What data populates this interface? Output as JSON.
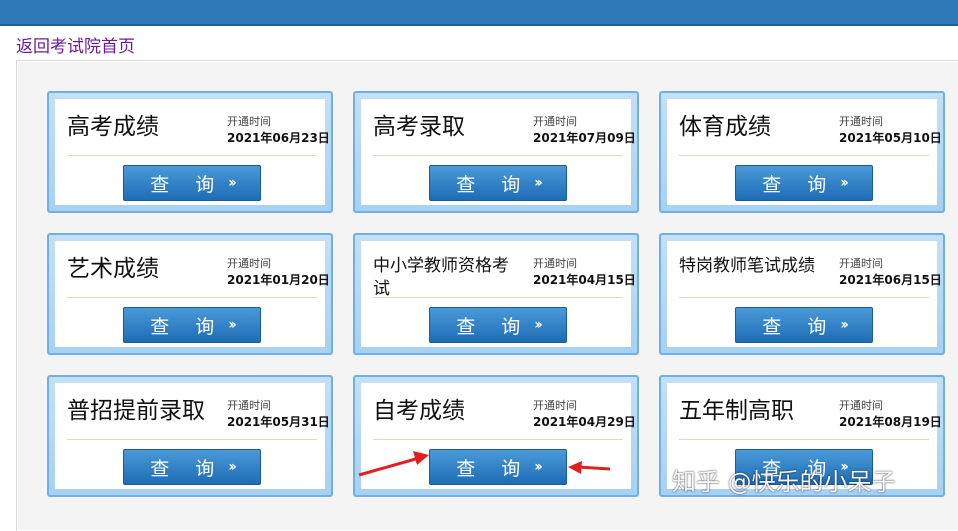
{
  "back_link": "返回考试院首页",
  "cards": [
    {
      "title": "高考成绩",
      "open_label": "开通时间",
      "open_date": "2021年06月23日",
      "button": "查 询"
    },
    {
      "title": "高考录取",
      "open_label": "开通时间",
      "open_date": "2021年07月09日",
      "button": "查 询"
    },
    {
      "title": "体育成绩",
      "open_label": "开通时间",
      "open_date": "2021年05月10日",
      "button": "查 询"
    },
    {
      "title": "艺术成绩",
      "open_label": "开通时间",
      "open_date": "2021年01月20日",
      "button": "查 询"
    },
    {
      "title": "中小学教师资格考试",
      "open_label": "开通时间",
      "open_date": "2021年04月15日",
      "button": "查 询"
    },
    {
      "title": "特岗教师笔试成绩",
      "open_label": "开通时间",
      "open_date": "2021年06月15日",
      "button": "查 询"
    },
    {
      "title": "普招提前录取",
      "open_label": "开通时间",
      "open_date": "2021年05月31日",
      "button": "查 询"
    },
    {
      "title": "自考成绩",
      "open_label": "开通时间",
      "open_date": "2021年04月29日",
      "button": "查 询"
    },
    {
      "title": "五年制高职",
      "open_label": "开通时间",
      "open_date": "2021年08月19日",
      "button": "查 询"
    }
  ],
  "button_arrow_icon": "double-chevron-right-icon",
  "annotation_arrow_color": "#e02020",
  "watermark": "知乎 @快乐的小呆子"
}
